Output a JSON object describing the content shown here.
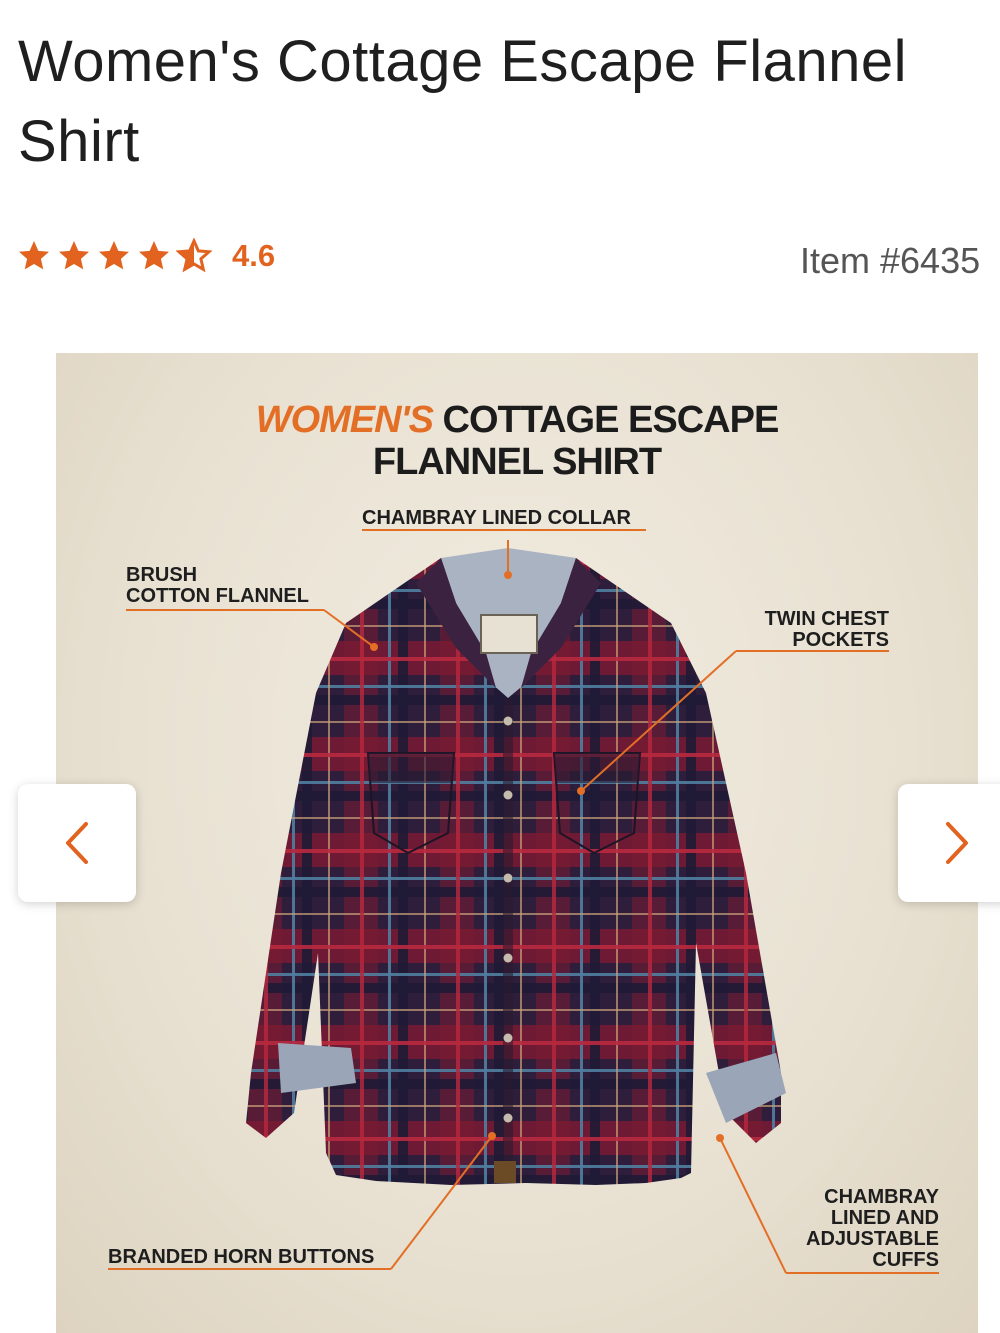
{
  "product": {
    "title": "Women's Cottage Escape Flannel Shirt",
    "rating": "4.6",
    "rating_stars": 4.5,
    "item_number": "Item #6435"
  },
  "hero": {
    "title_accent": "WOMEN'S",
    "title_rest_line1": "COTTAGE ESCAPE",
    "title_line2": "FLANNEL SHIRT",
    "callouts": {
      "collar": "CHAMBRAY LINED COLLAR",
      "brush": "BRUSH\nCOTTON FLANNEL",
      "pockets": "TWIN CHEST\nPOCKETS",
      "buttons": "BRANDED HORN BUTTONS",
      "cuffs": "CHAMBRAY\nLINED AND\nADJUSTABLE\nCUFFS"
    }
  },
  "colors": {
    "accent": "#e2631f",
    "shirt_base": "#3b2340",
    "shirt_red": "#8c1f35",
    "chambray": "#a9b3c4"
  },
  "icons": {
    "star": "star-icon",
    "prev": "chevron-left-icon",
    "next": "chevron-right-icon"
  }
}
